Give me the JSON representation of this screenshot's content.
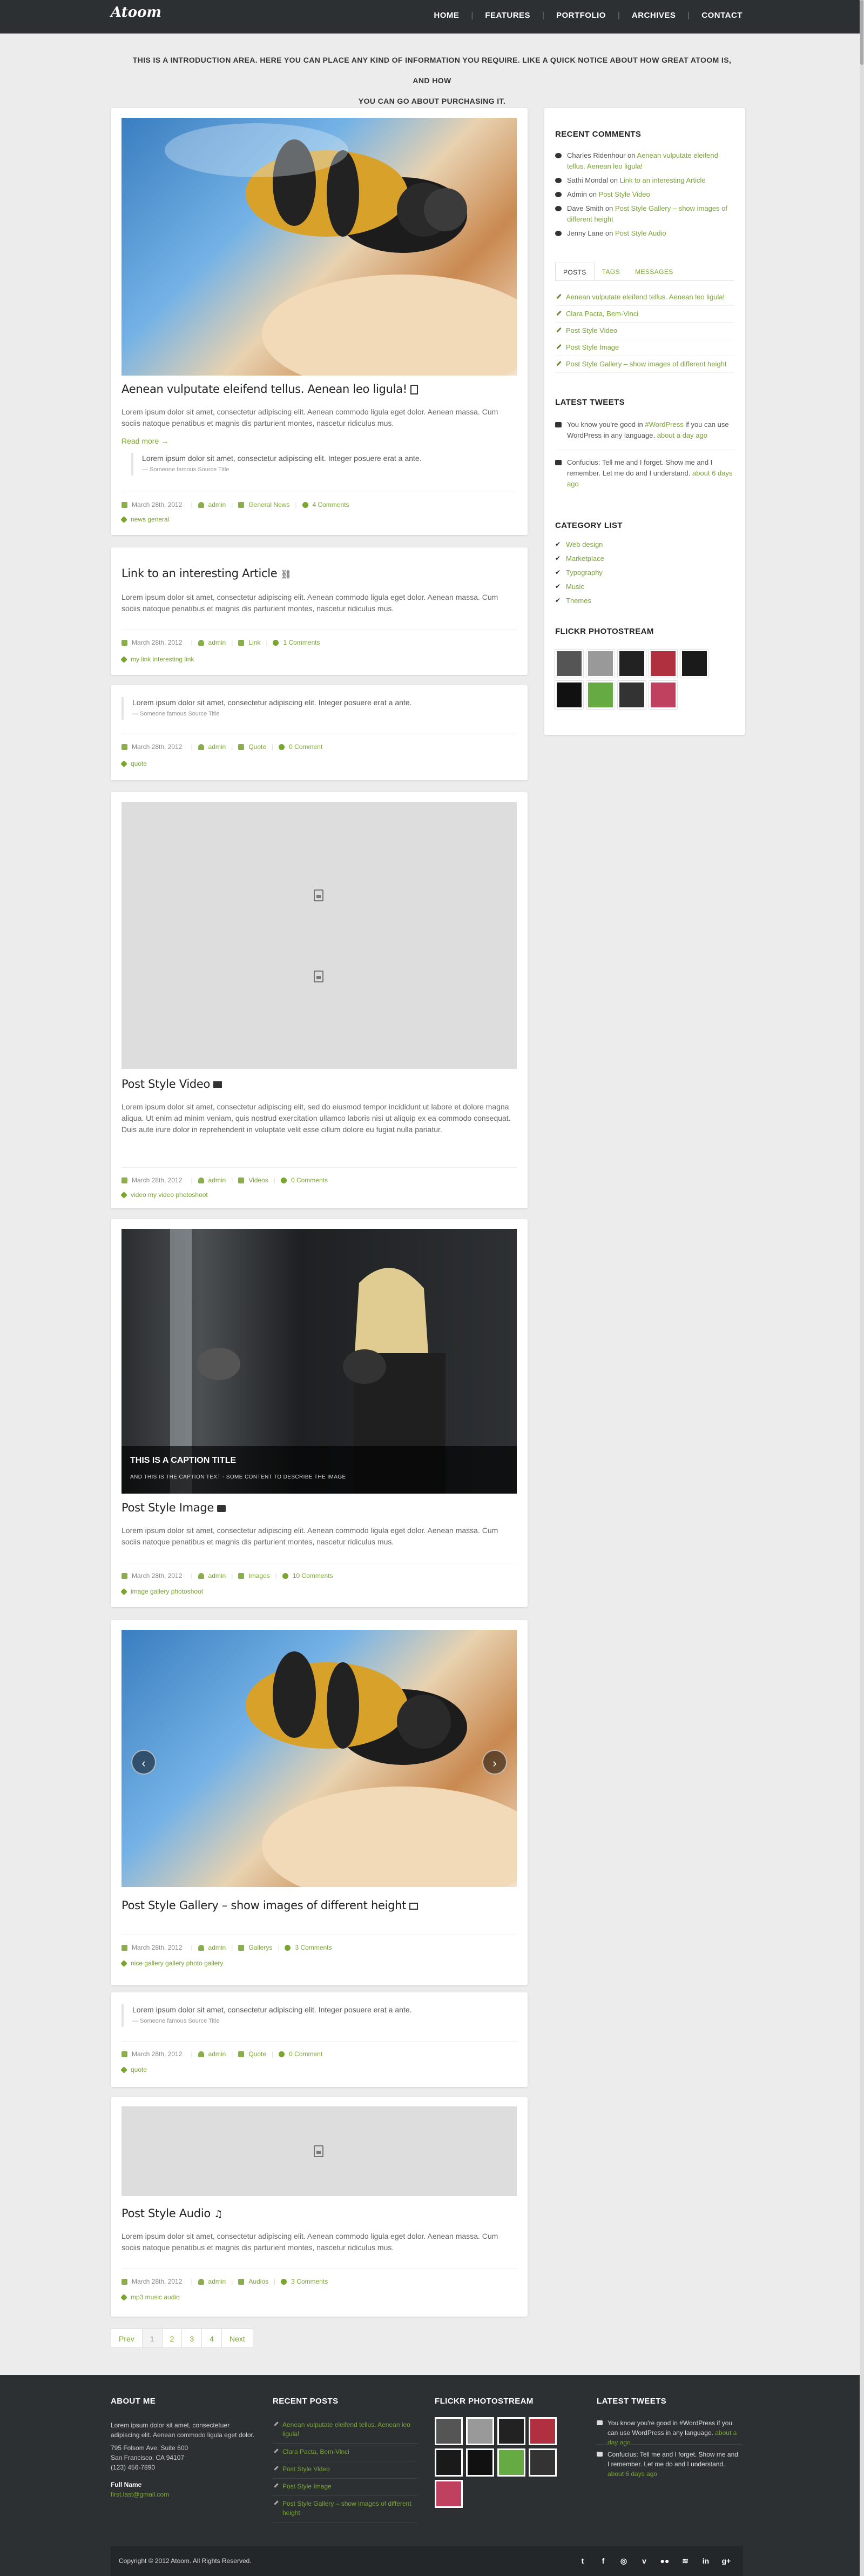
{
  "header": {
    "logo": "Atoom",
    "nav": [
      "HOME",
      "FEATURES",
      "PORTFOLIO",
      "ARCHIVES",
      "CONTACT"
    ]
  },
  "intro": {
    "line1": "THIS IS A INTRODUCTION AREA. HERE YOU CAN PLACE ANY KIND OF INFORMATION YOU REQUIRE. LIKE A QUICK NOTICE ABOUT HOW GREAT ATOOM IS, AND HOW",
    "line2": "YOU CAN GO ABOUT PURCHASING IT."
  },
  "lorem_short": "Lorem ipsum dolor sit amet, consectetur adipiscing elit. Aenean commodo ligula eget dolor. Aenean massa. Cum sociis natoque penatibus et magnis dis parturient montes, nascetur ridiculus mus.",
  "lorem_video": "Lorem ipsum dolor sit amet, consectetur adipiscing elit, sed do eiusmod tempor incididunt ut labore et dolore magna aliqua. Ut enim ad minim veniam, quis nostrud exercitation ullamco laboris nisi ut aliquip ex ea commodo consequat. Duis aute irure dolor in reprehenderit in voluptate velit esse cillum dolore eu fugiat nulla pariatur.",
  "quote_text": "Lorem ipsum dolor sit amet, consectetur adipiscing elit. Integer posuere erat a ante.",
  "quote_source": "— Someone famous Source Title",
  "read_more": "Read more →",
  "posts": [
    {
      "title": "Aenean vulputate eleifend tellus. Aenean leo ligula!",
      "date": "March 28th, 2012",
      "author": "admin",
      "category": "General News",
      "comments": "4 Comments",
      "tags": "news general"
    },
    {
      "title": "Link to an interesting Article",
      "date": "March 28th, 2012",
      "author": "admin",
      "category": "Link",
      "comments": "1 Comments",
      "tags": "my link interesting link"
    },
    {
      "title": "",
      "date": "March 28th, 2012",
      "author": "admin",
      "category": "Quote",
      "comments": "0 Comment",
      "tags": "quote"
    },
    {
      "title": "Post Style Video",
      "date": "March 28th, 2012",
      "author": "admin",
      "category": "Videos",
      "comments": "0 Comments",
      "tags": "video my video photoshoot"
    },
    {
      "title": "Post Style Image",
      "date": "March 28th, 2012",
      "author": "admin",
      "category": "Images",
      "comments": "10 Comments",
      "tags": "image gallery photoshoot",
      "caption_title": "THIS IS A CAPTION TITLE",
      "caption_text": "AND THIS IS THE CAPTION TEXT - SOME CONTENT TO DESCRIBE THE IMAGE"
    },
    {
      "title": "Post Style Gallery – show images of different height",
      "date": "March 28th, 2012",
      "author": "admin",
      "category": "Gallerys",
      "comments": "3 Comments",
      "tags": "nice gallery gallery photo gallery"
    },
    {
      "title": "",
      "date": "March 28th, 2012",
      "author": "admin",
      "category": "Quote",
      "comments": "0 Comment",
      "tags": "quote"
    },
    {
      "title": "Post Style Audio",
      "date": "March 28th, 2012",
      "author": "admin",
      "category": "Audios",
      "comments": "3 Comments",
      "tags": "mp3 music audio"
    }
  ],
  "sidebar": {
    "recent_comments_title": "RECENT COMMENTS",
    "recent_comments": [
      {
        "who": "Charles Ridenhour",
        "on": "on",
        "link": "Aenean vulputate eleifend tellus. Aenean leo ligula!"
      },
      {
        "who": "Sathi Mondal",
        "on": "on",
        "link": "Link to an interesting Article"
      },
      {
        "who": "Admin",
        "on": "on",
        "link": "Post Style Video"
      },
      {
        "who": "Dave Smith",
        "on": "on",
        "link": "Post Style Gallery – show images of different height"
      },
      {
        "who": "Jenny Lane",
        "on": "on",
        "link": "Post Style Audio"
      }
    ],
    "tabs": [
      "POSTS",
      "TAGS",
      "MESSAGES"
    ],
    "tab_posts": [
      "Aenean vulputate eleifend tellus. Aenean leo ligula!",
      "Clara Pacta, Bem-Vinci",
      "Post Style Video",
      "Post Style Image",
      "Post Style Gallery – show images of different height"
    ],
    "latest_tweets_title": "LATEST TWEETS",
    "tweets": [
      {
        "text": "You know you're good in",
        "link": "#WordPress",
        "rest": "if you can use WordPress in any language.",
        "when": "about a day ago"
      },
      {
        "text": "Confucius: Tell me and I forget. Show me and I remember. Let me do and I understand.",
        "link": "",
        "rest": "",
        "when": "about 6 days ago"
      }
    ],
    "category_title": "CATEGORY LIST",
    "categories": [
      "Web design",
      "Marketplace",
      "Typography",
      "Music",
      "Themes"
    ],
    "flickr_title": "FLICKR PHOTOSTREAM"
  },
  "pagination": [
    "Prev",
    "1",
    "2",
    "3",
    "4",
    "Next"
  ],
  "footer": {
    "about_title": "ABOUT ME",
    "about_text": "Lorem ipsum dolor sit amet, consectetuer adipiscing elit. Aenean commodo ligula eget dolor.",
    "address1": "795 Folsom Ave, Suite 600",
    "address2": "San Francisco, CA 94107",
    "phone": "(123) 456-7890",
    "fullname": "Full Name",
    "email": "first.last@gmail.com",
    "recent_posts_title": "RECENT POSTS",
    "recent_posts": [
      "Aenean vulputate eleifend tellus. Aenean leo ligula!",
      "Clara Pacta, Bem-Vinci",
      "Post Style Video",
      "Post Style Image",
      "Post Style Gallery – show images of different height"
    ],
    "flickr_title": "FLICKR PHOTOSTREAM",
    "tweets_title": "LATEST TWEETS",
    "tweet1": "You know you're good in #WordPress if you can use WordPress in any language.",
    "tweet1_when": "about a day ago",
    "tweet2": "Confucius: Tell me and I forget. Show me and I remember. Let me do and I understand.",
    "tweet2_when": "about 6 days ago",
    "copyright": "Copyright © 2012 Atoom. All Rights Reserved."
  },
  "colors": {
    "accent": "#7aa531",
    "dark": "#2c3033",
    "bg": "#ececec"
  }
}
